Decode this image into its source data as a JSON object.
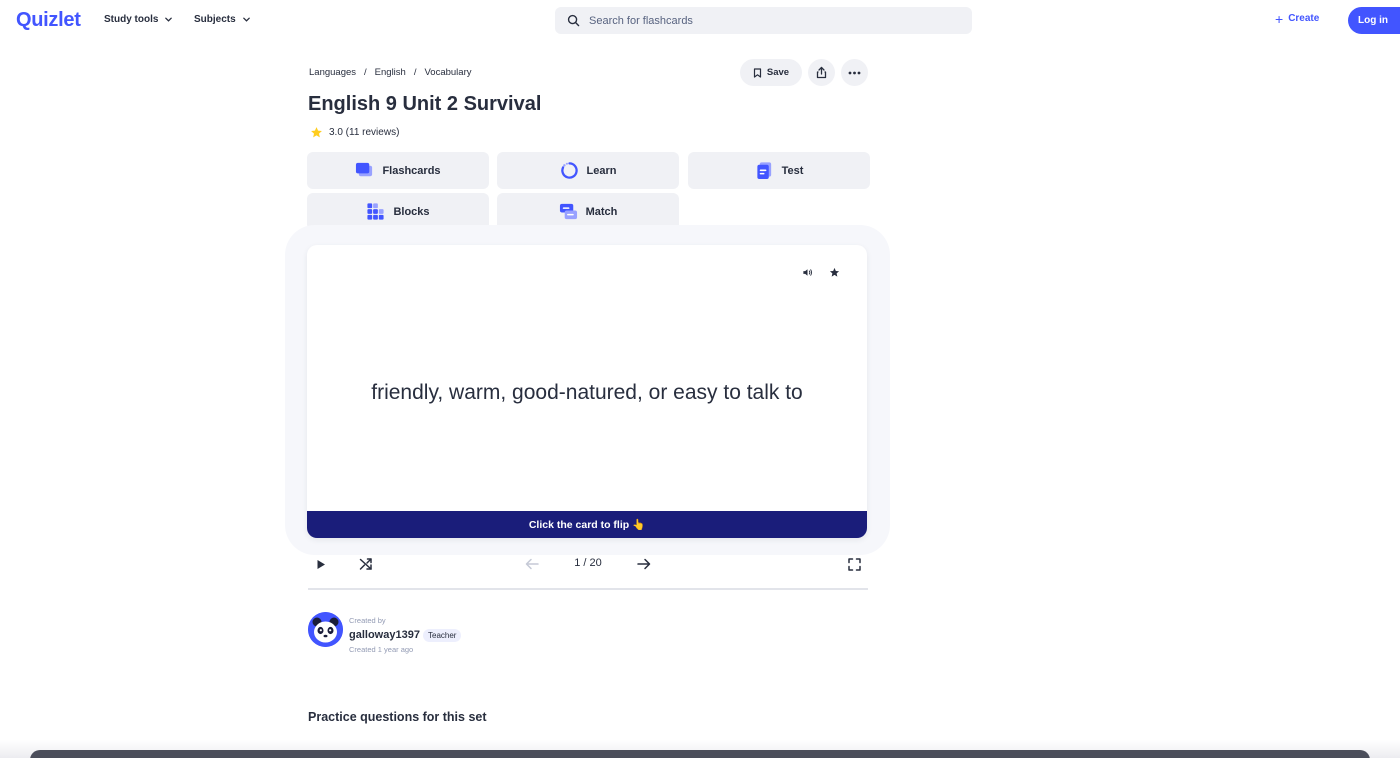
{
  "nav": {
    "logo": "Quizlet",
    "study_tools": "Study tools",
    "subjects": "Subjects",
    "search_placeholder": "Search for flashcards",
    "create": "Create",
    "login": "Log in"
  },
  "breadcrumb": [
    "Languages",
    "English",
    "Vocabulary"
  ],
  "breadcrumb_separator": "/",
  "actions": {
    "save": "Save"
  },
  "set": {
    "title": "English 9 Unit 2 Survival",
    "rating": "3.0 (11 reviews)"
  },
  "modes": [
    {
      "label": "Flashcards",
      "icon": "flashcards-icon"
    },
    {
      "label": "Learn",
      "icon": "learn-icon"
    },
    {
      "label": "Test",
      "icon": "test-icon"
    },
    {
      "label": "Blocks",
      "icon": "blocks-icon"
    },
    {
      "label": "Match",
      "icon": "match-icon"
    }
  ],
  "card": {
    "text": "friendly, warm, good-natured, or easy to talk to",
    "flip_hint": "Click the card to flip 👆"
  },
  "controls": {
    "counter": "1 / 20"
  },
  "creator": {
    "created_by_label": "Created by",
    "username": "galloway1397",
    "badge": "Teacher",
    "created_ago": "Created 1 year ago"
  },
  "practice": {
    "heading": "Practice questions for this set"
  },
  "colors": {
    "brand": "#4255ff",
    "card_footer": "#1a1d7a",
    "star": "#ffcd1f"
  }
}
